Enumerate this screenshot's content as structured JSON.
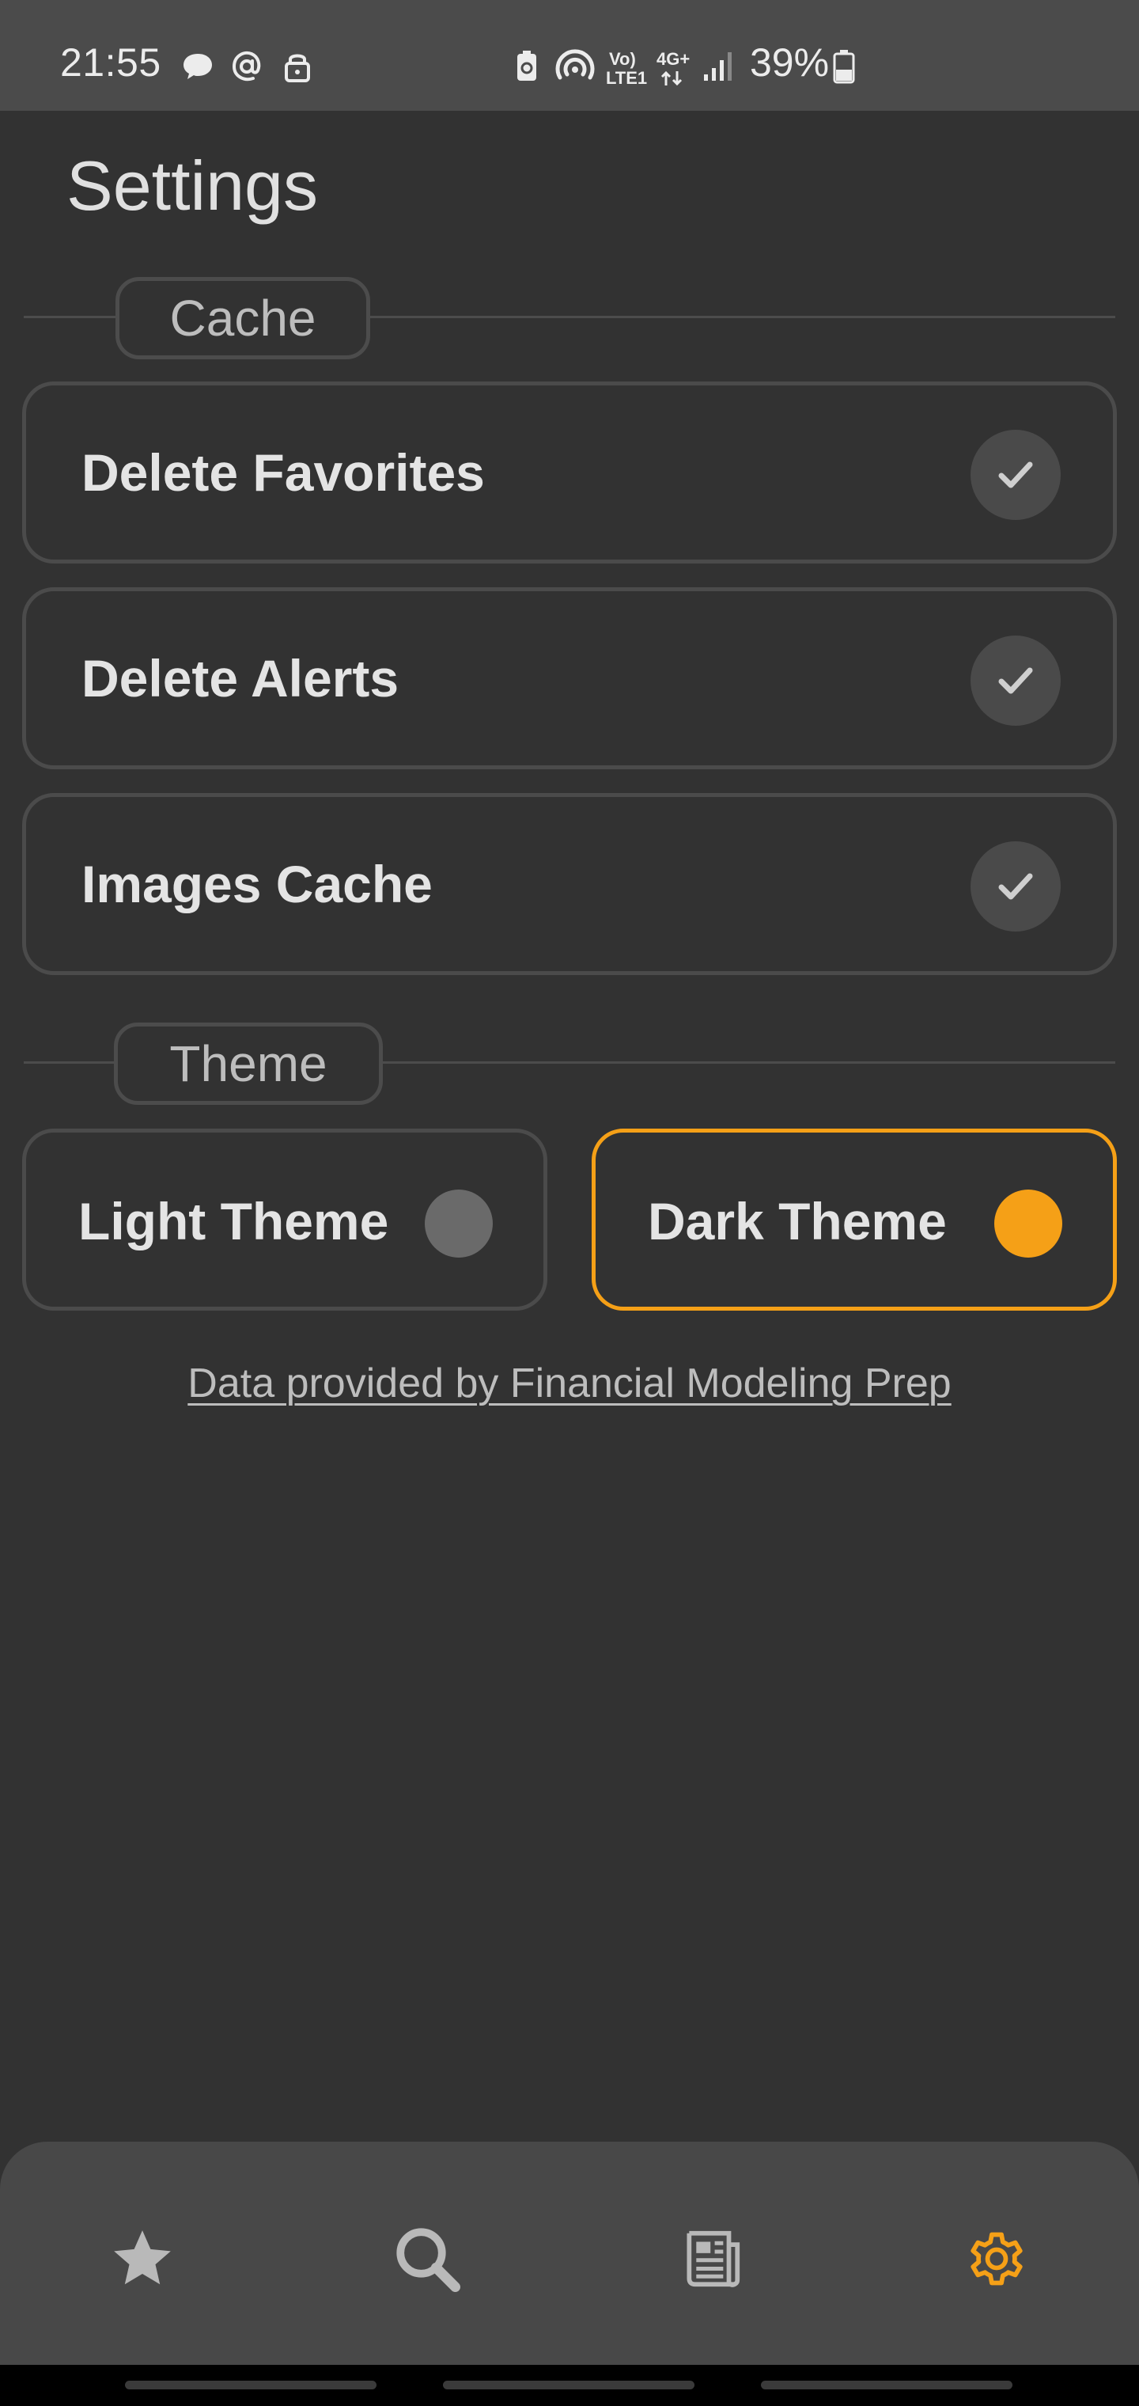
{
  "status_bar": {
    "time": "21:55",
    "battery": "39%",
    "network_top": "Vo)",
    "network_bottom": "LTE1",
    "data_type": "4G+"
  },
  "page": {
    "title": "Settings"
  },
  "cache_section": {
    "label": "Cache",
    "items": [
      {
        "label": "Delete Favorites"
      },
      {
        "label": "Delete Alerts"
      },
      {
        "label": "Images Cache"
      }
    ]
  },
  "theme_section": {
    "label": "Theme",
    "options": [
      {
        "label": "Light Theme",
        "selected": false,
        "dot_color": "#6a6a6a"
      },
      {
        "label": "Dark Theme",
        "selected": true,
        "dot_color": "#f5a017"
      }
    ]
  },
  "attribution": "Data provided by Financial Modeling Prep",
  "nav": {
    "items": [
      {
        "icon": "star-icon",
        "active": false
      },
      {
        "icon": "search-icon",
        "active": false
      },
      {
        "icon": "news-icon",
        "active": false
      },
      {
        "icon": "gear-icon",
        "active": true
      }
    ],
    "active_color": "#f5a017",
    "inactive_color": "#b9b9b9"
  },
  "colors": {
    "accent": "#f5a017",
    "background": "#323232",
    "card_border": "#4b4b4b"
  }
}
